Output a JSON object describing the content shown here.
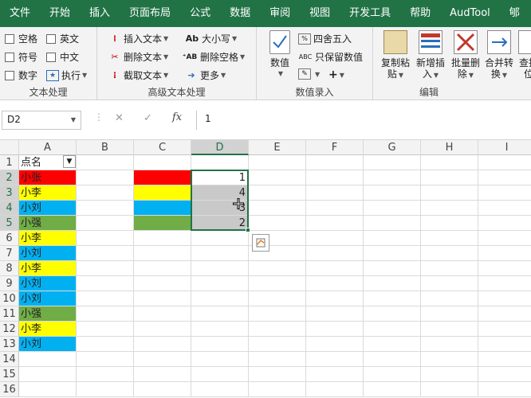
{
  "tabs": [
    "文件",
    "开始",
    "插入",
    "页面布局",
    "公式",
    "数据",
    "审阅",
    "视图",
    "开发工具",
    "帮助",
    "AudTool",
    "郇"
  ],
  "groups": {
    "text": {
      "label": "文本处理",
      "items": [
        "空格",
        "英文",
        "符号",
        "中文",
        "数字",
        "执行"
      ]
    },
    "advanced": {
      "label": "高级文本处理",
      "insert": "插入文本",
      "delete": "删除文本",
      "cut": "截取文本",
      "case": "大小写",
      "delspace": "删除空格",
      "more": "更多"
    },
    "entry": {
      "label": "数值录入",
      "value": "数值",
      "round": "四舍五入",
      "keep": "只保留数值",
      "plus": "+"
    },
    "edit": {
      "label": "编辑",
      "b1": [
        "复制粘",
        "贴"
      ],
      "b2": [
        "新增插",
        "入"
      ],
      "b3": [
        "批量删",
        "除"
      ],
      "b4": [
        "合并转",
        "换"
      ],
      "b5": [
        "查找",
        "位"
      ]
    }
  },
  "formula": {
    "namebox": "D2",
    "value": "1",
    "fx": "fx"
  },
  "columns": [
    "A",
    "B",
    "C",
    "D",
    "E",
    "F",
    "G",
    "H",
    "I"
  ],
  "rows": [
    "1",
    "2",
    "3",
    "4",
    "5",
    "6",
    "7",
    "8",
    "9",
    "10",
    "11",
    "12",
    "13",
    "14",
    "15",
    "16"
  ],
  "cells": {
    "A1": "点名",
    "A": [
      "小张",
      "小李",
      "小刘",
      "小强",
      "小李",
      "小刘",
      "小李",
      "小刘",
      "小刘",
      "小强",
      "小李",
      "小刘"
    ],
    "D": [
      "1",
      "4",
      "3",
      "2"
    ]
  },
  "colors": {
    "red": "#FF0000",
    "yellow": "#FFFF00",
    "blue": "#00B0F0",
    "green": "#70AD47",
    "ribbon": "#217346",
    "selection_fill": "#C9C9C9"
  }
}
